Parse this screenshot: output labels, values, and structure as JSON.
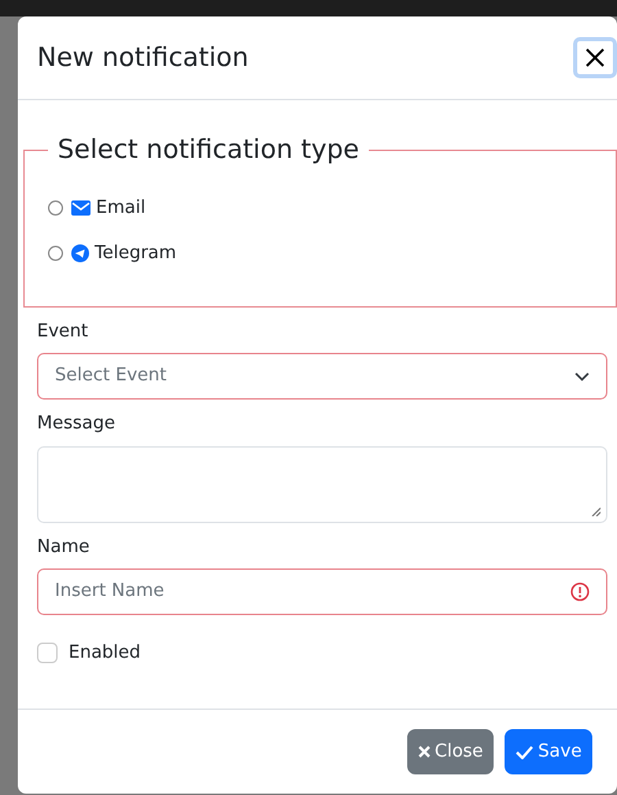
{
  "dialog": {
    "title": "New notification",
    "type_group": {
      "legend": "Select notification type",
      "invalid": true,
      "options": [
        {
          "label": "Email",
          "kind": "email",
          "selected": false
        },
        {
          "label": "Telegram",
          "kind": "telegram",
          "selected": false
        }
      ]
    },
    "fields": [
      {
        "kind": "select",
        "label": "Event",
        "placeholder": "Select Event",
        "invalid": true
      },
      {
        "kind": "textarea",
        "label": "Message",
        "invalid": false
      },
      {
        "kind": "input",
        "label": "Name",
        "placeholder": "Insert Name",
        "invalid": true
      }
    ],
    "enabled": {
      "label": "Enabled",
      "checked": false
    },
    "buttons": [
      {
        "label": "Close",
        "kind": "close"
      },
      {
        "label": "Save",
        "kind": "save"
      }
    ]
  }
}
